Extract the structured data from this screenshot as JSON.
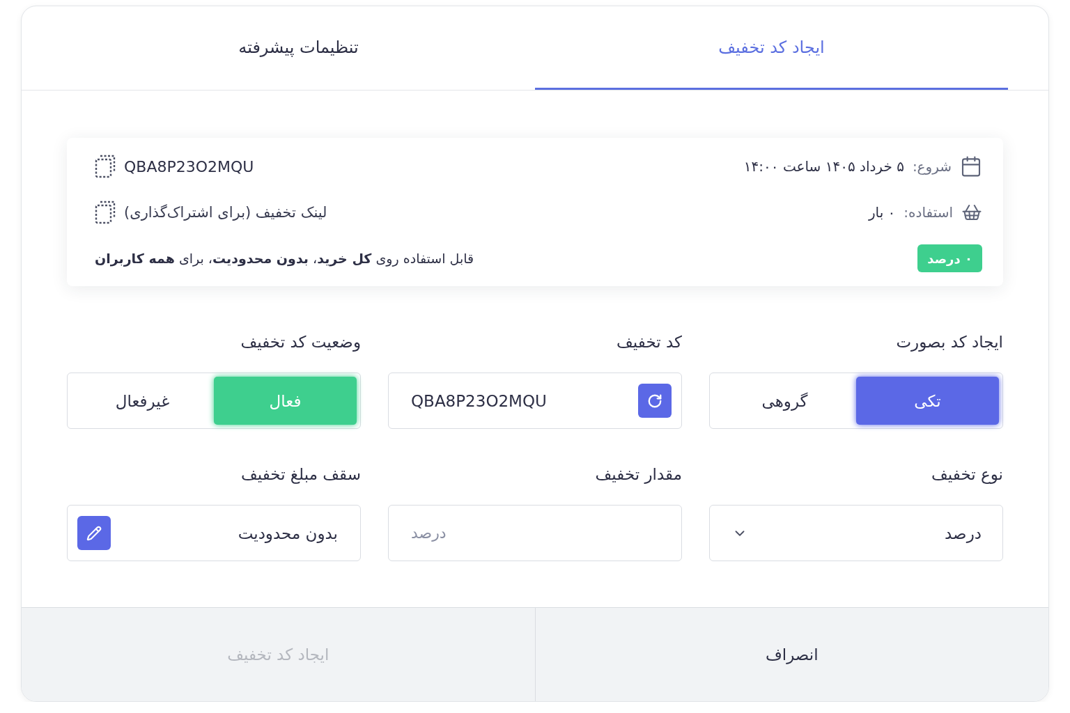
{
  "tabs": [
    {
      "label": "ایجاد کد تخفیف",
      "selected": true
    },
    {
      "label": "تنظیمات پیشرفته",
      "selected": false
    }
  ],
  "summary": {
    "start": {
      "label": "شروع:",
      "value": "۵ خرداد ۱۴۰۵ ساعت ۱۴:۰۰"
    },
    "usage": {
      "label": "استفاده:",
      "value": "۰ بار"
    },
    "badge": "۰ درصد",
    "code": "QBA8P23O2MQU",
    "link": "لینک تخفیف (برای اشتراک‌گذاری)",
    "description": "قابل استفاده روی **کل خرید**، **بدون محدودیت**، برای **همه کاربران**"
  },
  "fields": [
    {
      "kind": "segmented",
      "label": "ایجاد کد بصورت",
      "color": "#5b68e6",
      "options": [
        {
          "label": "تکی",
          "selected": true
        },
        {
          "label": "گروهی",
          "selected": false
        }
      ]
    },
    {
      "kind": "code",
      "label": "کد تخفیف",
      "value": "QBA8P23O2MQU"
    },
    {
      "kind": "segmented",
      "label": "وضعیت کد تخفیف",
      "color": "#3ecf8e",
      "options": [
        {
          "label": "فعال",
          "selected": true
        },
        {
          "label": "غیرفعال",
          "selected": false
        }
      ]
    },
    {
      "kind": "select",
      "label": "نوع تخفیف",
      "value": "درصد"
    },
    {
      "kind": "input",
      "label": "مقدار تخفیف",
      "placeholder": "درصد"
    },
    {
      "kind": "editable",
      "label": "سقف مبلغ تخفیف",
      "value": "بدون محدودیت"
    }
  ],
  "footer": {
    "buttons": [
      {
        "label": "انصراف",
        "disabled": false
      },
      {
        "label": "ایجاد کد تخفیف",
        "disabled": true
      }
    ]
  }
}
